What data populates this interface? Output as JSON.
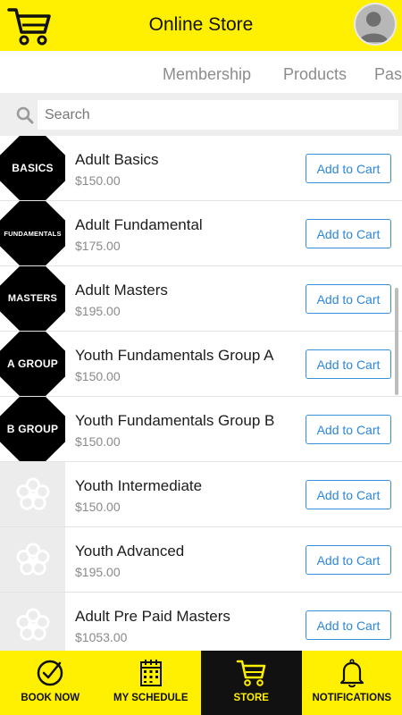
{
  "header": {
    "title": "Online Store"
  },
  "tabs": [
    "Membership",
    "Products",
    "Pass"
  ],
  "search": {
    "placeholder": "Search"
  },
  "products": [
    {
      "name": "Adult Basics",
      "price": "$150.00",
      "badge": "BASICS",
      "button": "Add to Cart"
    },
    {
      "name": "Adult Fundamental",
      "price": "$175.00",
      "badge": "FUNDAMENTALS",
      "button": "Add to Cart"
    },
    {
      "name": "Adult Masters",
      "price": "$195.00",
      "badge": "MASTERS",
      "button": "Add to Cart"
    },
    {
      "name": "Youth Fundamentals Group A",
      "price": "$150.00",
      "badge": "A GROUP",
      "button": "Add to Cart"
    },
    {
      "name": "Youth Fundamentals Group B",
      "price": "$150.00",
      "badge": "B GROUP",
      "button": "Add to Cart"
    },
    {
      "name": "Youth Intermediate",
      "price": "$150.00",
      "badge": "",
      "button": "Add to Cart"
    },
    {
      "name": "Youth Advanced",
      "price": "$195.00",
      "badge": "",
      "button": "Add to Cart"
    },
    {
      "name": "Adult Pre Paid Masters",
      "price": "$1053.00",
      "badge": "",
      "button": "Add to Cart"
    }
  ],
  "bottom_nav": [
    {
      "label": "BOOK NOW",
      "icon": "check-circle-icon"
    },
    {
      "label": "MY SCHEDULE",
      "icon": "calendar-icon"
    },
    {
      "label": "STORE",
      "icon": "cart-icon",
      "active": true
    },
    {
      "label": "NOTIFICATIONS",
      "icon": "bell-icon"
    }
  ],
  "colors": {
    "brand_yellow": "#ffef00",
    "accent_blue": "#2d86d6",
    "active_nav": "#111111"
  }
}
